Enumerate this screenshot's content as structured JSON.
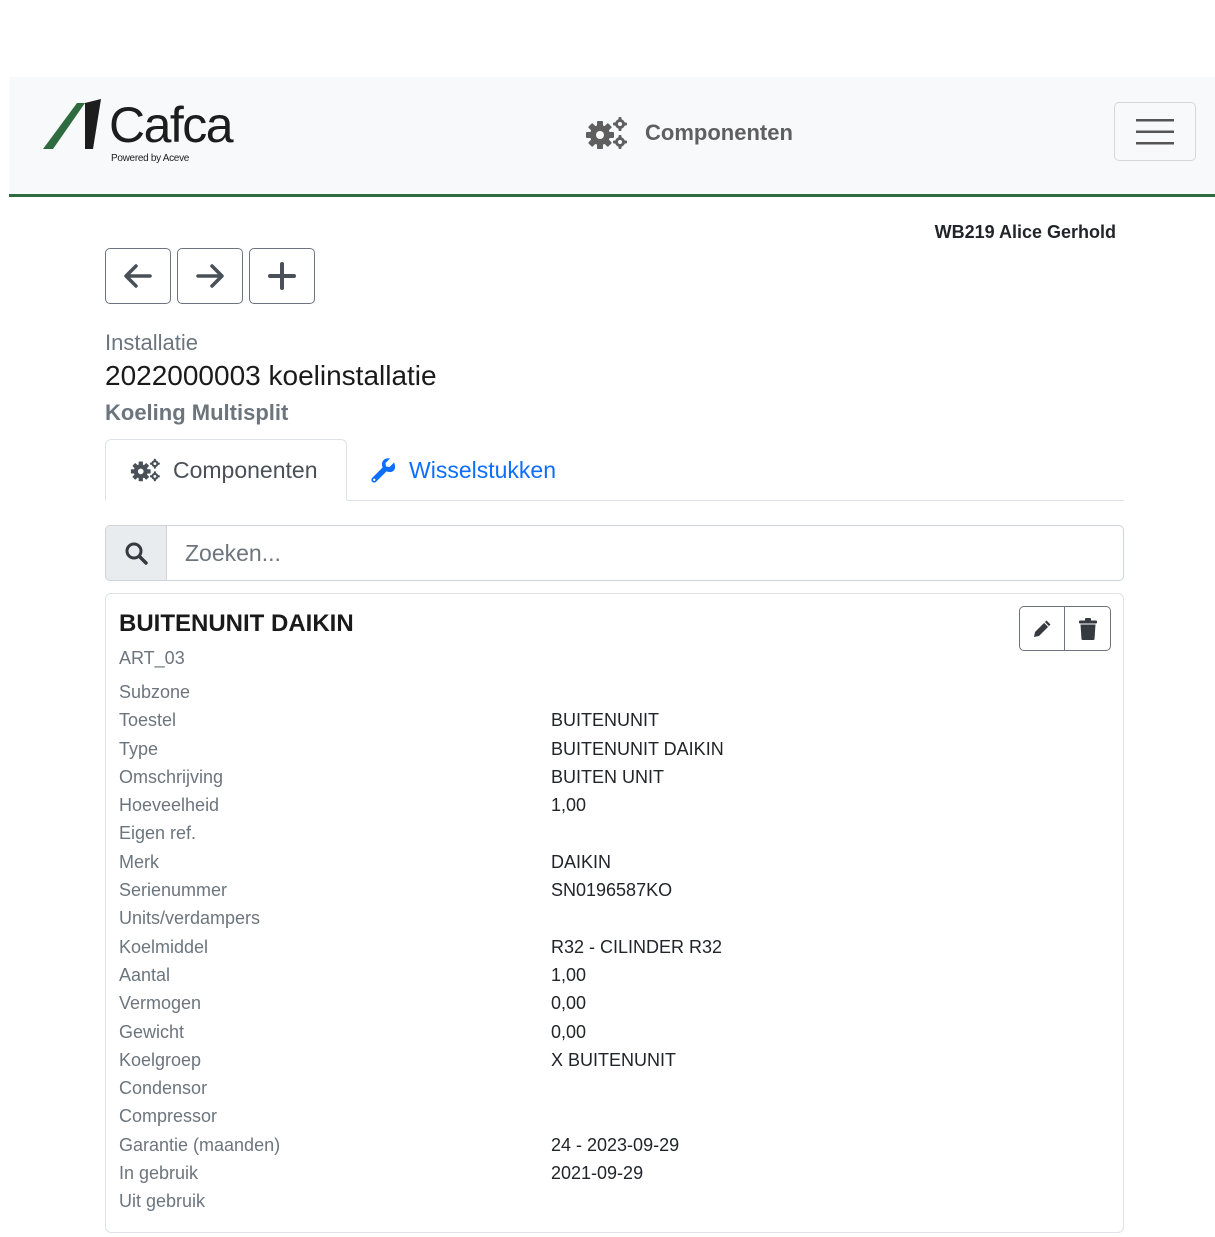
{
  "header": {
    "logo_text": "Cafca",
    "logo_subtext": "Powered by Aceve",
    "page_title": "Componenten",
    "page_icon": "gears-icon",
    "menu_icon": "hamburger-icon"
  },
  "user": {
    "name": "WB219 Alice Gerhold"
  },
  "toolbar": {
    "back_icon": "arrow-left-icon",
    "forward_icon": "arrow-right-icon",
    "add_icon": "plus-icon"
  },
  "installation": {
    "label": "Installatie",
    "title": "2022000003 koelinstallatie",
    "subtitle": "Koeling Multisplit"
  },
  "tabs": [
    {
      "label": "Componenten",
      "icon": "gears-icon",
      "active": true
    },
    {
      "label": "Wisselstukken",
      "icon": "wrench-icon",
      "active": false
    }
  ],
  "search": {
    "placeholder": "Zoeken...",
    "value": ""
  },
  "component": {
    "title": "BUITENUNIT DAIKIN",
    "code": "ART_03",
    "properties": [
      {
        "key": "Subzone",
        "value": ""
      },
      {
        "key": "Toestel",
        "value": "BUITENUNIT"
      },
      {
        "key": "Type",
        "value": "BUITENUNIT DAIKIN"
      },
      {
        "key": "Omschrijving",
        "value": "BUITEN UNIT"
      },
      {
        "key": "Hoeveelheid",
        "value": "1,00"
      },
      {
        "key": "Eigen ref.",
        "value": ""
      },
      {
        "key": "Merk",
        "value": "DAIKIN"
      },
      {
        "key": "Serienummer",
        "value": "SN0196587KO"
      },
      {
        "key": "Units/verdampers",
        "value": ""
      },
      {
        "key": "Koelmiddel",
        "value": "R32 - CILINDER R32"
      },
      {
        "key": "Aantal",
        "value": "1,00"
      },
      {
        "key": "Vermogen",
        "value": "0,00"
      },
      {
        "key": "Gewicht",
        "value": "0,00"
      },
      {
        "key": "Koelgroep",
        "value": "X BUITENUNIT"
      },
      {
        "key": "Condensor",
        "value": ""
      },
      {
        "key": "Compressor",
        "value": ""
      },
      {
        "key": "Garantie (maanden)",
        "value": "24 - 2023-09-29"
      },
      {
        "key": "In gebruik",
        "value": "2021-09-29"
      },
      {
        "key": "Uit gebruik",
        "value": ""
      }
    ]
  },
  "colors": {
    "accent_green": "#2e6b3e",
    "link_blue": "#0d6efd",
    "muted": "#6c757d"
  }
}
